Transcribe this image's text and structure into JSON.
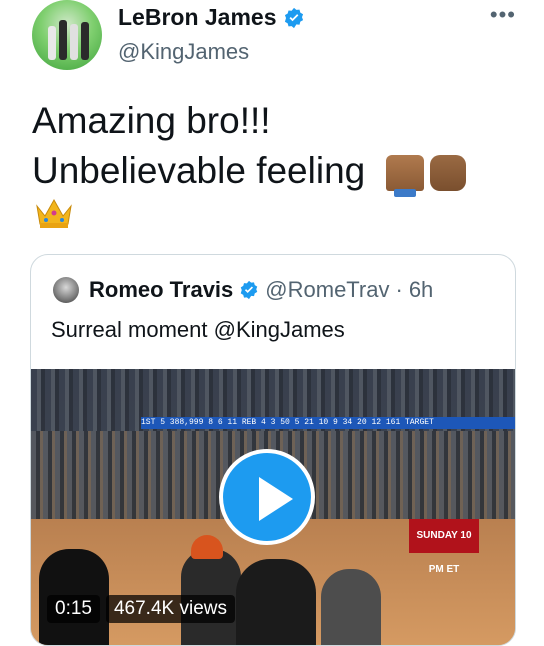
{
  "author": {
    "name": "LeBron James",
    "handle": "@KingJames",
    "verified": true,
    "more_icon": "more-horizontal-icon"
  },
  "tweet": {
    "line1": "Amazing bro!!!",
    "line2": "Unbelievable feeling",
    "emojis": [
      "folded-hands-emoji",
      "raised-fist-emoji",
      "crown-emoji"
    ]
  },
  "quoted": {
    "name": "Romeo Travis",
    "handle": "@RomeTrav",
    "time": "6h",
    "separator": "·",
    "text": "Surreal moment @KingJames",
    "video": {
      "duration": "0:15",
      "views": "467.4K views",
      "ad_text": "SUNDAY 10 PM ET",
      "scoreboard": "1ST 5 388,999   8 6 11 REB 4   3 50 5 21 10 9 34 20 12   161 TARGET"
    }
  },
  "colors": {
    "accent": "#1d9bf0",
    "text": "#0f1419",
    "secondary_text": "#536471",
    "border": "#cfd9de"
  }
}
